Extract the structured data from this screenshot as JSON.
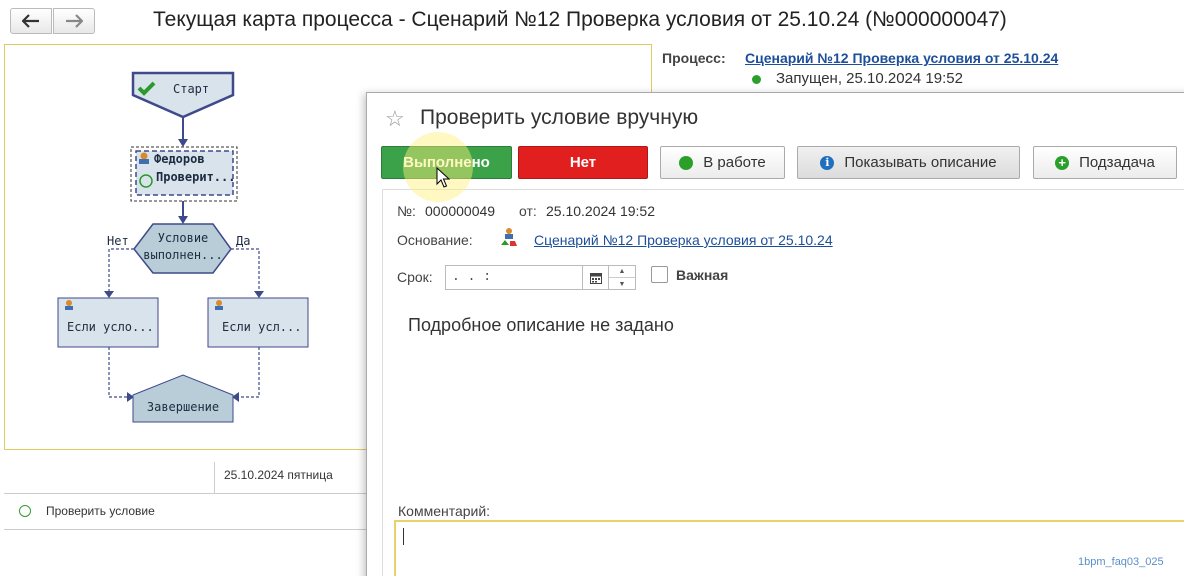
{
  "window": {
    "title": "Текущая карта процесса - Сценарий №12 Проверка условия от 25.10.24 (№000000047)",
    "back_icon": "arrow-left-icon",
    "forward_icon": "arrow-right-icon"
  },
  "diagram": {
    "start_label": "Старт",
    "task_user": "Федоров",
    "task_name": "Проверит...",
    "condition_label_1": "Условие",
    "condition_label_2": "выполнен...",
    "branch_no": "Нет",
    "branch_yes": "Да",
    "left_node": "Если усло...",
    "right_node": "Если усл...",
    "end_label": "Завершение",
    "colors": {
      "node_fill": "#d8e3ec",
      "node_stroke": "#3f4a8a",
      "frame": "#e2c960"
    }
  },
  "timeline": {
    "date": "25.10.2024 пятница",
    "task": "Проверить условие"
  },
  "process": {
    "label": "Процесс:",
    "link": "Сценарий №12 Проверка условия от 25.10.24",
    "status": "Запущен, 25.10.2024 19:52"
  },
  "dialog": {
    "title": "Проверить условие вручную",
    "buttons": {
      "done": "Выполнено",
      "no": "Нет",
      "in_work": "В работе",
      "show_desc": "Показывать описание",
      "subtask": "Подзадача"
    },
    "number_label": "№:",
    "number_value": "000000049",
    "from_label": "от:",
    "from_value": "25.10.2024 19:52",
    "basis_label": "Основание:",
    "basis_link": "Сценарий №12 Проверка условия от 25.10.24",
    "due_label": "Срок:",
    "due_value": " .  .      :  ",
    "important_label": "Важная",
    "important_checked": false,
    "description": "Подробное описание не задано",
    "comment_label": "Комментарий:",
    "comment_value": ""
  },
  "watermark": "1bpm_faq03_025"
}
